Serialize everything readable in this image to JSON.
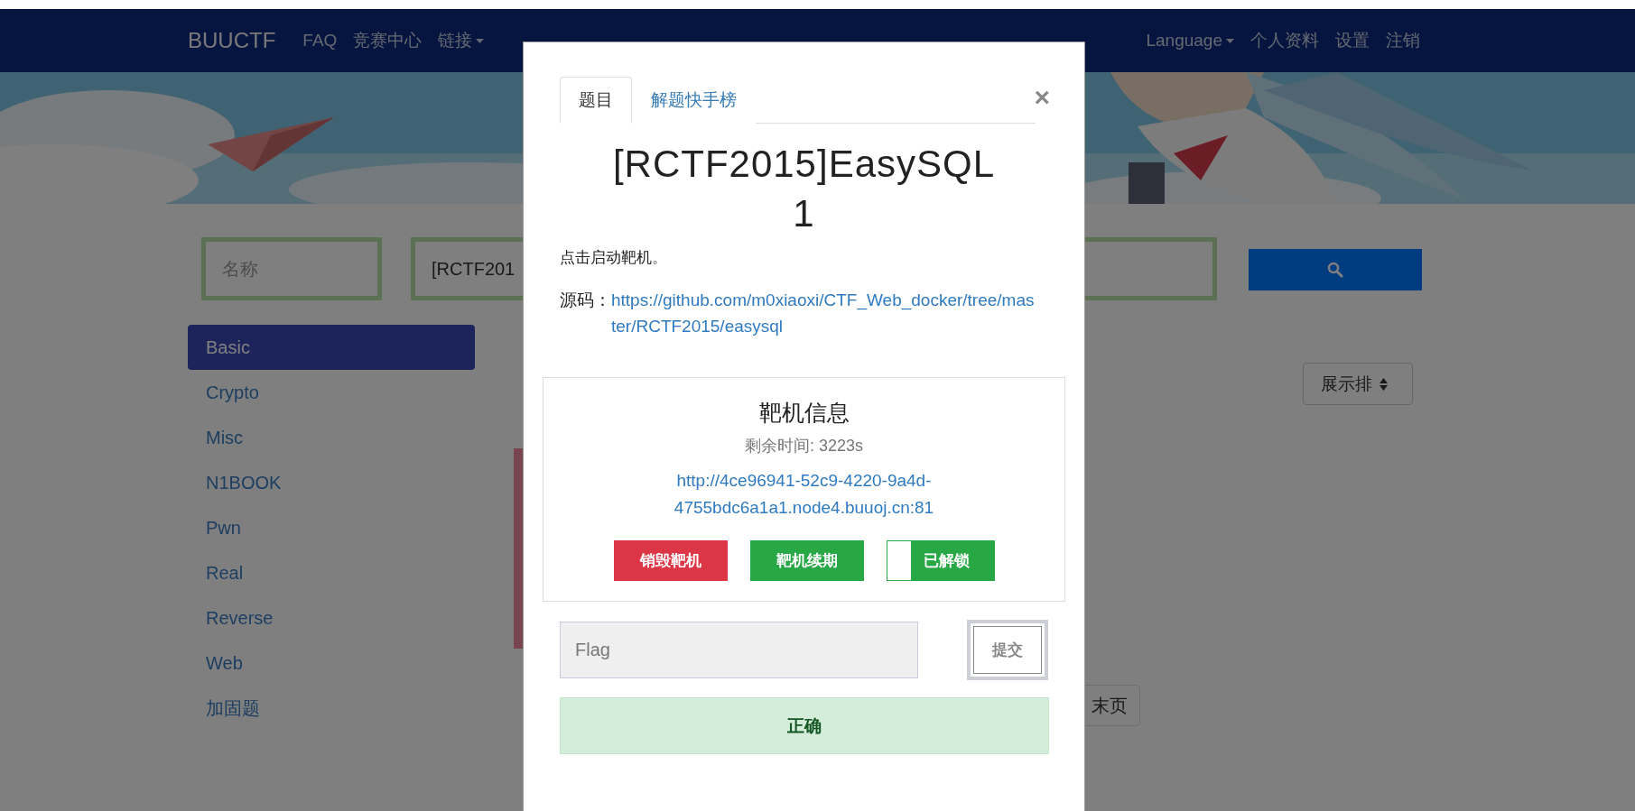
{
  "nav": {
    "brand": "BUUCTF",
    "items": [
      {
        "label": "FAQ",
        "dropdown": false
      },
      {
        "label": "竞赛中心",
        "dropdown": false
      },
      {
        "label": "链接",
        "dropdown": true
      }
    ],
    "right": [
      {
        "label": "Language",
        "dropdown": true
      },
      {
        "label": "个人资料",
        "dropdown": false
      },
      {
        "label": "设置",
        "dropdown": false
      },
      {
        "label": "注销",
        "dropdown": false
      }
    ]
  },
  "search": {
    "name_placeholder": "名称",
    "query_value": "[RCTF201"
  },
  "sidebar": {
    "items": [
      {
        "label": "Basic",
        "selected": true
      },
      {
        "label": "Crypto",
        "selected": false
      },
      {
        "label": "Misc",
        "selected": false
      },
      {
        "label": "N1BOOK",
        "selected": false
      },
      {
        "label": "Pwn",
        "selected": false
      },
      {
        "label": "Real",
        "selected": false
      },
      {
        "label": "Reverse",
        "selected": false
      },
      {
        "label": "Web",
        "selected": false
      },
      {
        "label": "加固题",
        "selected": false
      }
    ]
  },
  "sort_select": {
    "value": "展示排"
  },
  "pagination": {
    "last": "末页"
  },
  "modal": {
    "tabs": [
      {
        "label": "题目",
        "selected": true
      },
      {
        "label": "解题快手榜",
        "selected": false
      }
    ],
    "close": "×",
    "title": "[RCTF2015]EasySQL 1",
    "description": "点击启动靶机。",
    "source_label": "源码：",
    "source_url": "https://github.com/m0xiaoxi/CTF_Web_docker/tree/master/RCTF2015/easysql",
    "target": {
      "heading": "靶机信息",
      "remaining": "剩余时间: 3223s",
      "url": "http://4ce96941-52c9-4220-9a4d-4755bdc6a1a1.node4.buuoj.cn:81",
      "actions": [
        {
          "kind": "danger",
          "label": "销毁靶机"
        },
        {
          "kind": "success",
          "label": "靶机续期"
        },
        {
          "kind": "toggle",
          "label": "已解锁",
          "on": true
        }
      ]
    },
    "flag": {
      "placeholder": "Flag",
      "submit": "提交"
    },
    "result": {
      "kind": "success",
      "text": "正确"
    }
  }
}
